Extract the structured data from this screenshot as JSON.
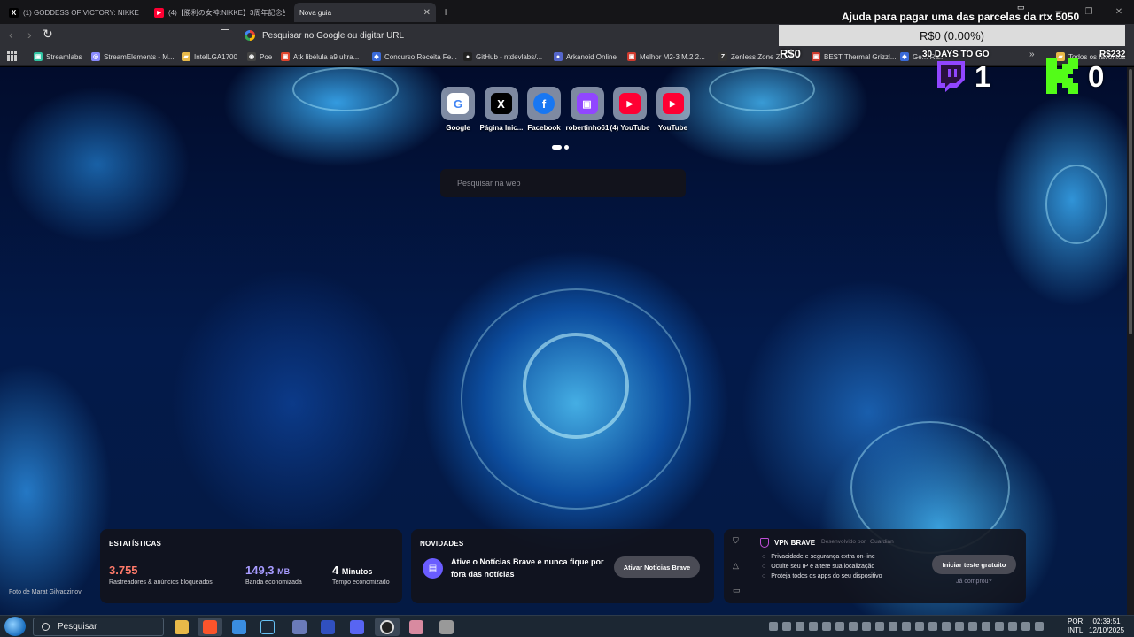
{
  "browser": {
    "tabs": [
      {
        "title": "(1) GODDESS OF VICTORY: NIKKE Co",
        "icon": "x-icon",
        "color": "#000000"
      },
      {
        "title": "(4)【勝利の女神:NIKKE】3周年記念生",
        "icon": "youtube-icon",
        "color": "#ff0033"
      },
      {
        "title": "Nova guia",
        "icon": "",
        "color": ""
      }
    ],
    "address": {
      "placeholder": "Pesquisar no Google ou digitar URL"
    },
    "bookmarks": [
      {
        "label": "Streamlabs",
        "color": "#31c3a2",
        "icon": "streamlabs-icon"
      },
      {
        "label": "StreamElements - M...",
        "color": "#8a8aff",
        "icon": "streamelements-icon"
      },
      {
        "label": "IntelLGA1700",
        "color": "#e8b949",
        "icon": "folder-icon"
      },
      {
        "label": "Poe",
        "color": "#444444",
        "icon": "poe-icon"
      },
      {
        "label": "Atk libélula a9 ultra...",
        "color": "#e0452e",
        "icon": "shop-icon"
      },
      {
        "label": "Concurso Receita Fe...",
        "color": "#3a6ad8",
        "icon": "link-icon"
      },
      {
        "label": "GitHub - ntdevlabs/...",
        "color": "#222222",
        "icon": "github-icon"
      },
      {
        "label": "Arkanoid Online",
        "color": "#5566cc",
        "icon": "globe-icon"
      },
      {
        "label": "Melhor M2-3 M.2 2...",
        "color": "#d03a2e",
        "icon": "shop-icon"
      },
      {
        "label": "Zenless Zone Z...",
        "color": "#333333",
        "icon": "game-icon"
      },
      {
        "label": "BEST Thermal Grizzl...",
        "color": "#d03a2e",
        "icon": "shop-icon"
      },
      {
        "label": "Ge... Ra...",
        "color": "#3a6ad8",
        "icon": "link-icon"
      },
      {
        "label": "Todos os favoritos",
        "color": "#e8b949",
        "icon": "folder-icon"
      }
    ]
  },
  "newtab": {
    "top_sites": [
      {
        "label": "Google",
        "icon": "google-icon",
        "color": "#4285f4",
        "glyph": "G"
      },
      {
        "label": "Página Inic...",
        "icon": "x-icon",
        "color": "#000000",
        "glyph": "X"
      },
      {
        "label": "Facebook",
        "icon": "facebook-icon",
        "color": "#1877f2",
        "glyph": "f"
      },
      {
        "label": "robertinho61",
        "icon": "twitch-icon",
        "color": "#9146ff",
        "glyph": "⬛"
      },
      {
        "label": "(4) YouTube",
        "icon": "youtube-icon",
        "color": "#ff0033",
        "glyph": "▶"
      },
      {
        "label": "YouTube",
        "icon": "youtube-icon",
        "color": "#ff0033",
        "glyph": "▶"
      }
    ],
    "search_placeholder": "Pesquisar na web",
    "photo_credit": "Foto de Marat Gilyadzinov",
    "stats": {
      "title": "ESTATÍSTICAS",
      "blocked_value": "3.755",
      "blocked_label": "Rastreadores & anúncios bloqueados",
      "bandwidth_value": "149,3",
      "bandwidth_unit": "MB",
      "bandwidth_label": "Banda economizada",
      "time_value": "4",
      "time_unit": "Minutos",
      "time_label": "Tempo economizado"
    },
    "news": {
      "title": "NOVIDADES",
      "text": "Ative o Notícias Brave e nunca fique por fora das notícias",
      "button": "Ativar Notícias Brave"
    },
    "vpn": {
      "title": "VPN BRAVE",
      "developer": "Desenvolvido por",
      "developer_name": "Guardian",
      "features": [
        "Privacidade e segurança extra on-line",
        "Oculte seu IP e altere sua localização",
        "Proteja todos os apps do seu dispositivo"
      ],
      "button": "Iniciar teste gratuito",
      "link": "Já comprou?"
    }
  },
  "overlay": {
    "goal_title": "Ajuda para pagar uma das parcelas da rtx 5050",
    "goal_bar": "R$0 (0.00%)",
    "goal_left": "R$0",
    "goal_days": "30 DAYS TO GO",
    "goal_right": "R$232",
    "twitch_count": "1",
    "kick_count": "0",
    "twitch_color": "#9146ff",
    "kick_color": "#53fc18"
  },
  "taskbar": {
    "search_placeholder": "Pesquisar",
    "lang_1": "POR",
    "lang_2": "INTL",
    "time": "02:39:51",
    "date": "12/10/2025"
  }
}
